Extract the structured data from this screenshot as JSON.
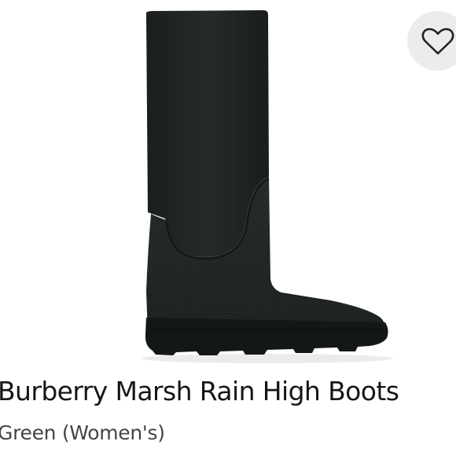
{
  "product": {
    "title": "Burberry Marsh Rain High Boots",
    "subtitle": "Green (Women's)",
    "image_icon": "boot-photo",
    "colors": {
      "boot": "#1f2420",
      "title_text": "#161616",
      "subtitle_text": "#444444",
      "fav_background": "#ececec"
    }
  },
  "favorite": {
    "icon": "heart-outline-icon"
  }
}
